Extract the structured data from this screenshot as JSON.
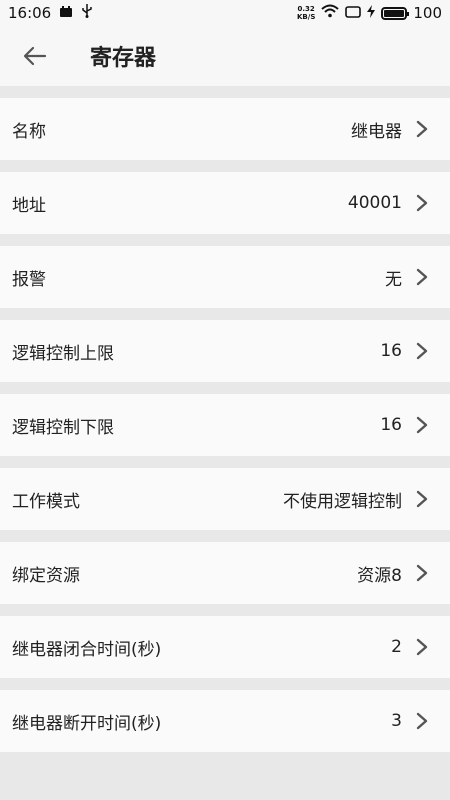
{
  "status_bar": {
    "time": "16:06",
    "net_speed_value": "0.32",
    "net_speed_unit": "KB/S",
    "battery": "100"
  },
  "header": {
    "title": "寄存器",
    "back_icon": "arrow-left-icon"
  },
  "rows": [
    {
      "label": "名称",
      "value": "继电器"
    },
    {
      "label": "地址",
      "value": "40001"
    },
    {
      "label": "报警",
      "value": "无"
    },
    {
      "label": "逻辑控制上限",
      "value": "16"
    },
    {
      "label": "逻辑控制下限",
      "value": "16"
    },
    {
      "label": "工作模式",
      "value": "不使用逻辑控制"
    },
    {
      "label": "绑定资源",
      "value": "资源8"
    },
    {
      "label": "继电器闭合时间(秒)",
      "value": "2"
    },
    {
      "label": "继电器断开时间(秒)",
      "value": "3"
    }
  ]
}
